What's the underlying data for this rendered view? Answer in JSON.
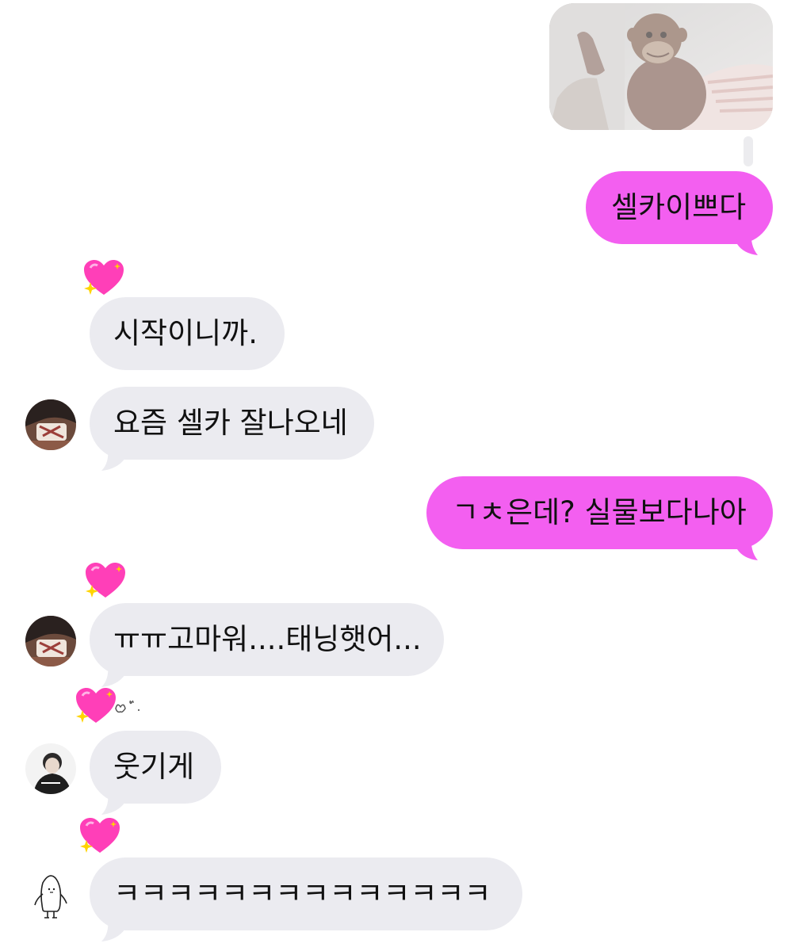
{
  "messages": {
    "sent_1": "셀카이쁘다",
    "recv_1": "시작이니까.",
    "recv_2": "요즘 셀카 잘나오네",
    "sent_2": "ㄱㅊ은데? 실물보다나아",
    "recv_3": "ㅠㅠ고마워....태닝햇어...",
    "recv_4": "웃기게",
    "recv_5": "ㅋㅋㅋㅋㅋㅋㅋㅋㅋㅋㅋㅋㅋㅋ"
  },
  "colors": {
    "sent_bubble": "#f35ff0",
    "received_bubble": "#ebebf0",
    "heart": "#ff3fb8"
  },
  "icons": {
    "reaction": "sparkling-heart-icon",
    "photo": "monkey-plush-photo"
  }
}
